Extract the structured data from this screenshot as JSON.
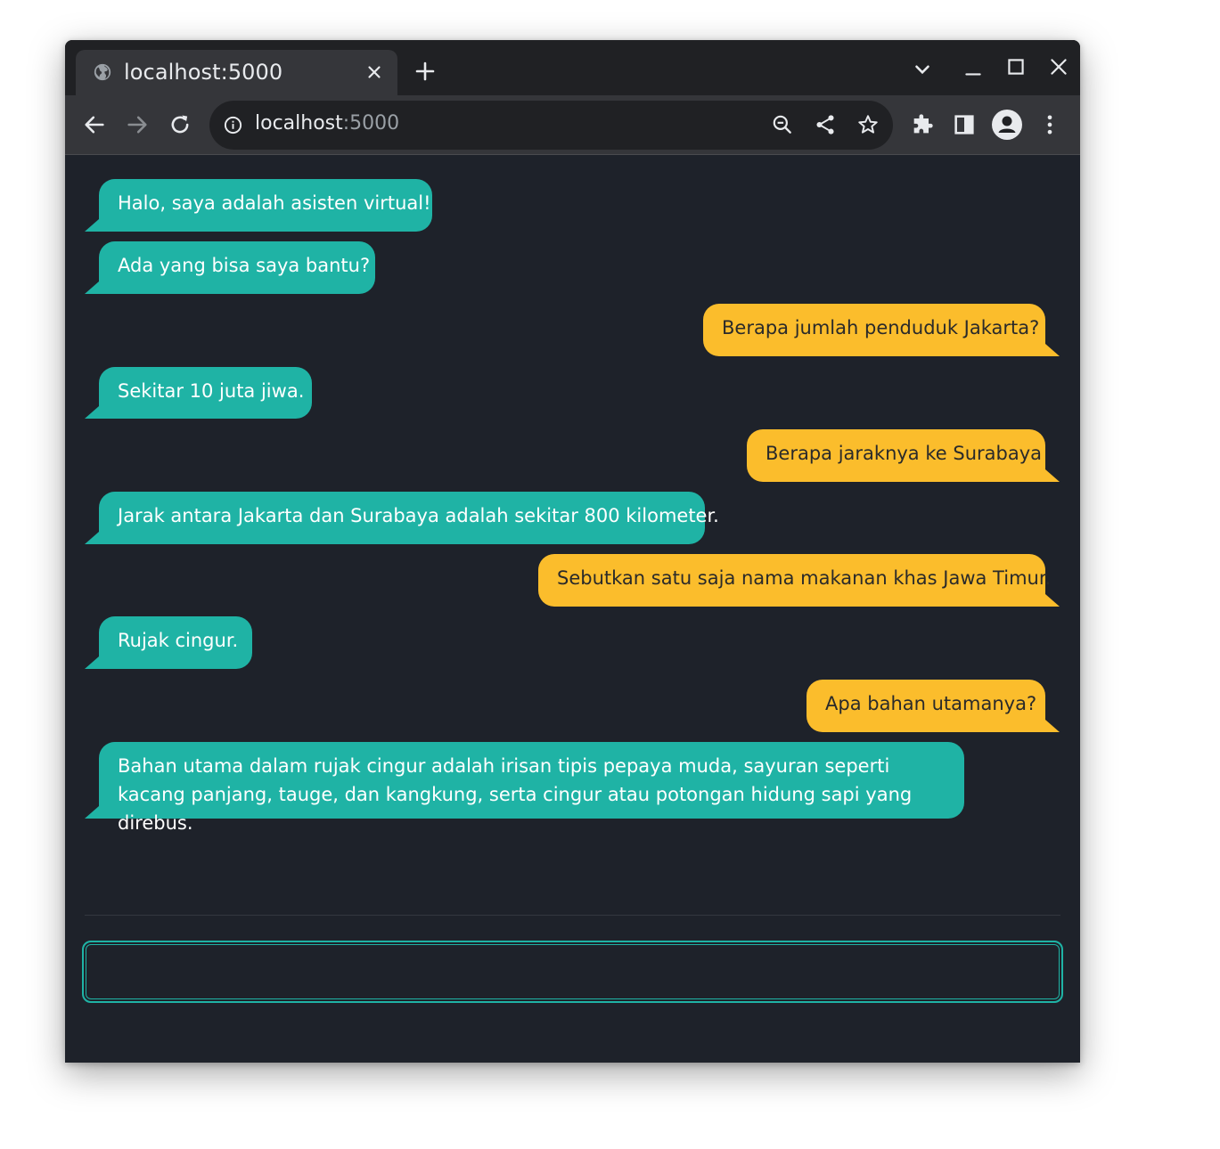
{
  "browser": {
    "tab_title": "localhost:5000",
    "url_host": "localhost",
    "url_port": ":5000"
  },
  "chat": {
    "messages": [
      {
        "role": "bot",
        "text": "Halo, saya adalah asisten virtual!"
      },
      {
        "role": "bot",
        "text": "Ada yang bisa saya bantu?"
      },
      {
        "role": "user",
        "text": "Berapa jumlah penduduk Jakarta?"
      },
      {
        "role": "bot",
        "text": "Sekitar 10 juta jiwa."
      },
      {
        "role": "user",
        "text": "Berapa jaraknya ke Surabaya"
      },
      {
        "role": "bot",
        "text": "Jarak antara Jakarta dan Surabaya adalah sekitar 800 kilometer."
      },
      {
        "role": "user",
        "text": "Sebutkan satu saja nama makanan khas Jawa Timur."
      },
      {
        "role": "bot",
        "text": "Rujak cingur."
      },
      {
        "role": "user",
        "text": "Apa bahan utamanya?"
      },
      {
        "role": "bot",
        "text": "Bahan utama dalam rujak cingur adalah irisan tipis pepaya muda, sayuran seperti kacang panjang, tauge, dan kangkung, serta cingur atau potongan hidung sapi yang direbus."
      }
    ],
    "input_value": "",
    "input_placeholder": ""
  },
  "colors": {
    "bot_bubble": "#1fb3a5",
    "user_bubble": "#fbbd2c",
    "page_bg": "#1e222a"
  }
}
